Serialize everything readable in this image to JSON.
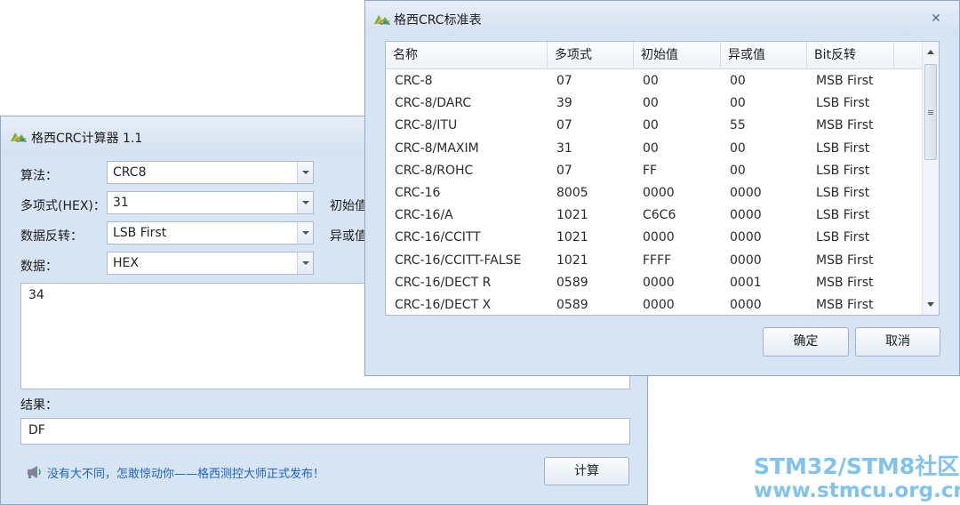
{
  "calculator": {
    "title": "格西CRC计算器 1.1",
    "algorithm": {
      "label": "算法：",
      "value": "CRC8"
    },
    "polynomial": {
      "label": "多项式(HEX)：",
      "value": "31"
    },
    "reflect": {
      "label": "数据反转：",
      "value": "LSB First"
    },
    "data_format": {
      "label": "数据：",
      "value": "HEX"
    },
    "init_value_label_partial": "初始值",
    "xor_value_label_partial": "异或值",
    "data_input": "34",
    "result_label": "结果：",
    "result_value": "DF",
    "promo_text": "没有大不同，怎敢惊动你——格西测控大师正式发布！",
    "calculate_button": "计算"
  },
  "crc_table_dialog": {
    "title": "格西CRC标准表",
    "close_glyph": "✕",
    "columns": [
      "名称",
      "多项式",
      "初始值",
      "异或值",
      "Bit反转"
    ],
    "rows": [
      [
        "CRC-8",
        "07",
        "00",
        "00",
        "MSB First"
      ],
      [
        "CRC-8/DARC",
        "39",
        "00",
        "00",
        "LSB First"
      ],
      [
        "CRC-8/ITU",
        "07",
        "00",
        "55",
        "MSB First"
      ],
      [
        "CRC-8/MAXIM",
        "31",
        "00",
        "00",
        "LSB First"
      ],
      [
        "CRC-8/ROHC",
        "07",
        "FF",
        "00",
        "LSB First"
      ],
      [
        "CRC-16",
        "8005",
        "0000",
        "0000",
        "LSB First"
      ],
      [
        "CRC-16/A",
        "1021",
        "C6C6",
        "0000",
        "LSB First"
      ],
      [
        "CRC-16/CCITT",
        "1021",
        "0000",
        "0000",
        "LSB First"
      ],
      [
        "CRC-16/CCITT-FALSE",
        "1021",
        "FFFF",
        "0000",
        "MSB First"
      ],
      [
        "CRC-16/DECT R",
        "0589",
        "0000",
        "0001",
        "MSB First"
      ],
      [
        "CRC-16/DECT X",
        "0589",
        "0000",
        "0000",
        "MSB First"
      ]
    ],
    "ok_button": "确定",
    "cancel_button": "取消"
  },
  "watermark": {
    "line1": "STM32/STM8社区",
    "line2": "www.stmcu.org.cn"
  }
}
